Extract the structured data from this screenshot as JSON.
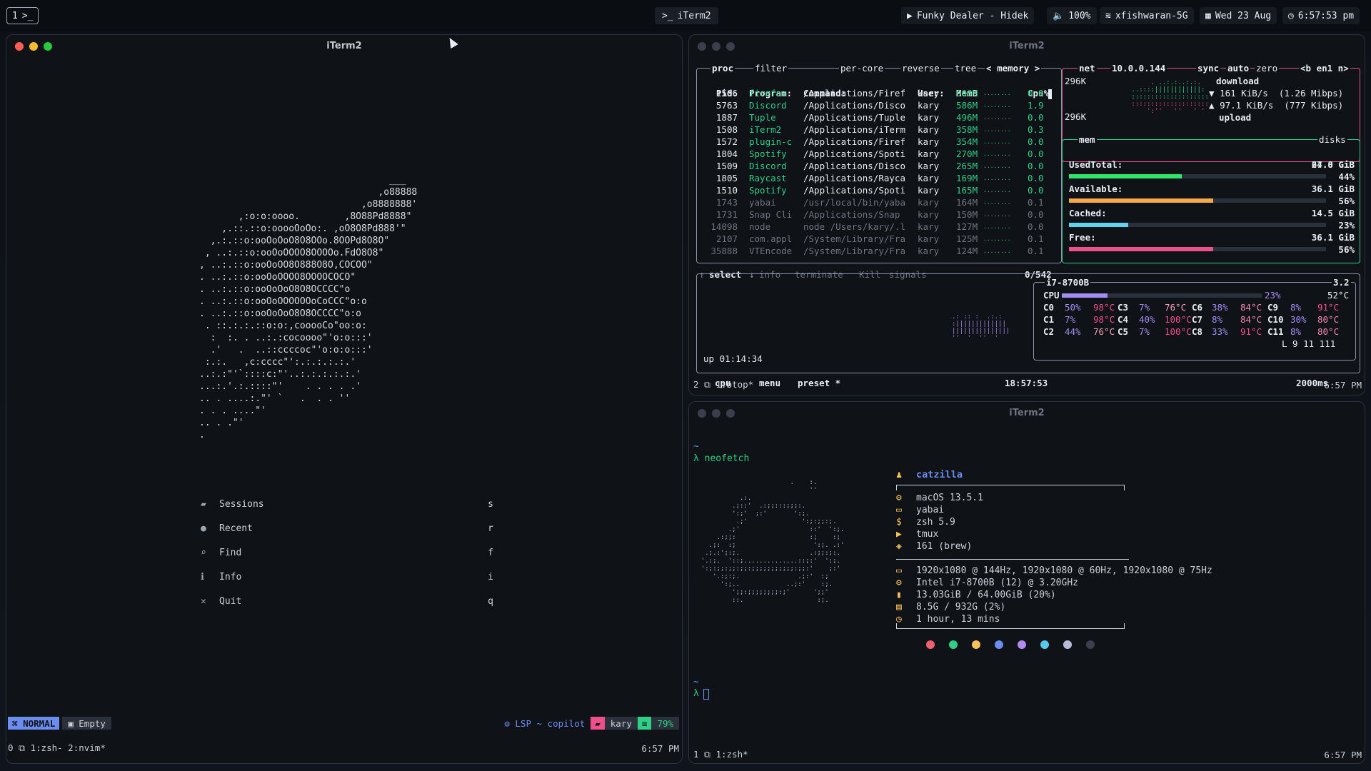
{
  "menubar": {
    "workspace": "1",
    "workspace_icon": ">_",
    "center_app": "iTerm2",
    "music": "Funky Dealer - Hidek",
    "volume": "100%",
    "wifi": "xfishwaran-5G",
    "date": "Wed 23 Aug",
    "time": "6:57:53 pm"
  },
  "left_window": {
    "title": "iTerm2",
    "menu": [
      {
        "label": "Sessions",
        "key": "s",
        "icon": "folder-icon"
      },
      {
        "label": "Recent",
        "key": "r",
        "icon": "clock-icon"
      },
      {
        "label": "Find",
        "key": "f",
        "icon": "search-icon"
      },
      {
        "label": "Info",
        "key": "i",
        "icon": "info-icon"
      },
      {
        "label": "Quit",
        "key": "q",
        "icon": "close-icon"
      }
    ],
    "statusline": {
      "mode": "NORMAL",
      "buffer": "Empty",
      "lsp": "LSP ~ copilot",
      "user": "kary",
      "percent": "79%"
    },
    "tmux": {
      "left": "0 ⧉ 1:zsh- 2:nvim*",
      "right": "6:57 PM"
    }
  },
  "btop_window": {
    "title": "iTerm2",
    "proc_header": {
      "proc": "proc",
      "filter": "filter",
      "percore": "per-core",
      "reverse": "reverse",
      "tree": "tree",
      "memory": "memory"
    },
    "columns": [
      "Pid:",
      "Program:",
      "Command:",
      "User:",
      "MemB",
      "Cpu%"
    ],
    "rows": [
      {
        "pid": "1506",
        "prog": "firefox",
        "cmd": "/Applications/Firef",
        "user": "kary",
        "mem": "906M",
        "cpu": "0.0"
      },
      {
        "pid": "5763",
        "prog": "Discord",
        "cmd": "/Applications/Disco",
        "user": "kary",
        "mem": "586M",
        "cpu": "1.9"
      },
      {
        "pid": "1887",
        "prog": "Tuple",
        "cmd": "/Applications/Tuple",
        "user": "kary",
        "mem": "496M",
        "cpu": "0.0"
      },
      {
        "pid": "1508",
        "prog": "iTerm2",
        "cmd": "/Applications/iTerm",
        "user": "kary",
        "mem": "358M",
        "cpu": "0.3"
      },
      {
        "pid": "1572",
        "prog": "plugin-c",
        "cmd": "/Applications/Firef",
        "user": "kary",
        "mem": "354M",
        "cpu": "0.0"
      },
      {
        "pid": "1804",
        "prog": "Spotify",
        "cmd": "/Applications/Spoti",
        "user": "kary",
        "mem": "270M",
        "cpu": "0.0"
      },
      {
        "pid": "1509",
        "prog": "Discord",
        "cmd": "/Applications/Disco",
        "user": "kary",
        "mem": "265M",
        "cpu": "0.0"
      },
      {
        "pid": "1805",
        "prog": "Raycast",
        "cmd": "/Applications/Rayca",
        "user": "kary",
        "mem": "169M",
        "cpu": "0.0"
      },
      {
        "pid": "1510",
        "prog": "Spotify",
        "cmd": "/Applications/Spoti",
        "user": "kary",
        "mem": "165M",
        "cpu": "0.0"
      },
      {
        "pid": "1743",
        "prog": "yabai",
        "cmd": "/usr/local/bin/yaba",
        "user": "kary",
        "mem": "164M",
        "cpu": "0.1"
      },
      {
        "pid": "1731",
        "prog": "Snap Cli",
        "cmd": "/Applications/Snap",
        "user": "kary",
        "mem": "150M",
        "cpu": "0.0"
      },
      {
        "pid": "14098",
        "prog": "node",
        "cmd": "node /Users/kary/.l",
        "user": "kary",
        "mem": "127M",
        "cpu": "0.0"
      },
      {
        "pid": "2107",
        "prog": "com.appl",
        "cmd": "/System/Library/Fra",
        "user": "kary",
        "mem": "125M",
        "cpu": "0.1"
      },
      {
        "pid": "35888",
        "prog": "VTEncode",
        "cmd": "/System/Library/Fra",
        "user": "kary",
        "mem": "124M",
        "cpu": "0.1"
      }
    ],
    "proc_footer": {
      "select": "select",
      "info": "info",
      "terminate": "terminate",
      "kill": "Kill",
      "signals": "signals",
      "count": "0/542"
    },
    "net": {
      "label": "net",
      "ip": "10.0.0.144",
      "sync": "sync",
      "auto": "auto",
      "zero": "zero",
      "iface": "<b en1 n>",
      "top": "296K",
      "bottom": "296K",
      "download": "download",
      "dl_rate": "161 KiB/s",
      "dl_mbps": "(1.26 Mibps)",
      "ul_rate": "97.1 KiB/s",
      "ul_kbps": "(777 Kibps)",
      "upload": "upload"
    },
    "mem": {
      "label": "mem",
      "disks": "disks",
      "total_label": "Total:",
      "total": "64.0 GiB",
      "items": [
        {
          "label": "Used:",
          "value": "27.8 GiB",
          "pct": "44%",
          "frac": 0.44,
          "color": "#2ee66b"
        },
        {
          "label": "Available:",
          "value": "36.1 GiB",
          "pct": "56%",
          "frac": 0.56,
          "color": "#f6a94a"
        },
        {
          "label": "Cached:",
          "value": "14.5 GiB",
          "pct": "23%",
          "frac": 0.23,
          "color": "#5ed4f0"
        },
        {
          "label": "Free:",
          "value": "36.1 GiB",
          "pct": "56%",
          "frac": 0.56,
          "color": "#f0508a"
        }
      ]
    },
    "cpu": {
      "model": "i7-8700B",
      "freq": "3.2",
      "total_label": "CPU",
      "total_pct": "23%",
      "temp": "52°C",
      "cores": [
        [
          "C0",
          "50%",
          "98°C",
          "C3",
          "7%",
          "76°C",
          "C6",
          "38%",
          "84°C",
          "C9",
          "8%",
          "91°C"
        ],
        [
          "C1",
          "7%",
          "98°C",
          "C4",
          "40%",
          "100°C",
          "C7",
          "8%",
          "84°C",
          "C10",
          "30%",
          "80°C"
        ],
        [
          "C2",
          "44%",
          "76°C",
          "C5",
          "7%",
          "100°C",
          "C8",
          "33%",
          "91°C",
          "C11",
          "8%",
          "80°C"
        ]
      ],
      "load": "L 9 11 111",
      "uptime": "up 01:14:34",
      "cpu_tab": "cpu",
      "menu_tab": "menu",
      "preset": "preset *",
      "clock": "18:57:53",
      "interval": "2000ms"
    },
    "tmux": {
      "left": "2 ⧉ 1:btop*",
      "right": "6:57 PM"
    }
  },
  "neofetch_window": {
    "title": "iTerm2",
    "prompt1": "~",
    "cmd": "λ neofetch",
    "user": "catzilla",
    "info": [
      {
        "icon": "gear-icon",
        "text": "macOS 13.5.1"
      },
      {
        "icon": "window-icon",
        "text": "yabai"
      },
      {
        "icon": "dollar-icon",
        "text": "zsh 5.9"
      },
      {
        "icon": "terminal-icon",
        "text": "tmux"
      },
      {
        "icon": "package-icon",
        "text": "161 (brew)"
      }
    ],
    "info2": [
      {
        "icon": "monitor-icon",
        "text": "1920x1080 @ 144Hz, 1920x1080 @ 60Hz, 1920x1080 @ 75Hz"
      },
      {
        "icon": "cpu-icon",
        "text": "Intel i7-8700B (12) @ 3.20GHz"
      },
      {
        "icon": "memory-icon",
        "text": "13.03GiB / 64.00GiB (20%)"
      },
      {
        "icon": "disk-icon",
        "text": "8.5G / 932G (2%)"
      },
      {
        "icon": "clock-icon",
        "text": "1 hour, 13 mins"
      }
    ],
    "palette": [
      "#f25f6e",
      "#2ed088",
      "#f6c05a",
      "#6b8cf0",
      "#b08cf0",
      "#55c8f0",
      "#b8bcd8",
      "#3a3f4b"
    ],
    "prompt2": "~",
    "prompt3": "λ",
    "tmux": {
      "left": "1 ⧉ 1:zsh*",
      "right": "6:57 PM"
    }
  }
}
